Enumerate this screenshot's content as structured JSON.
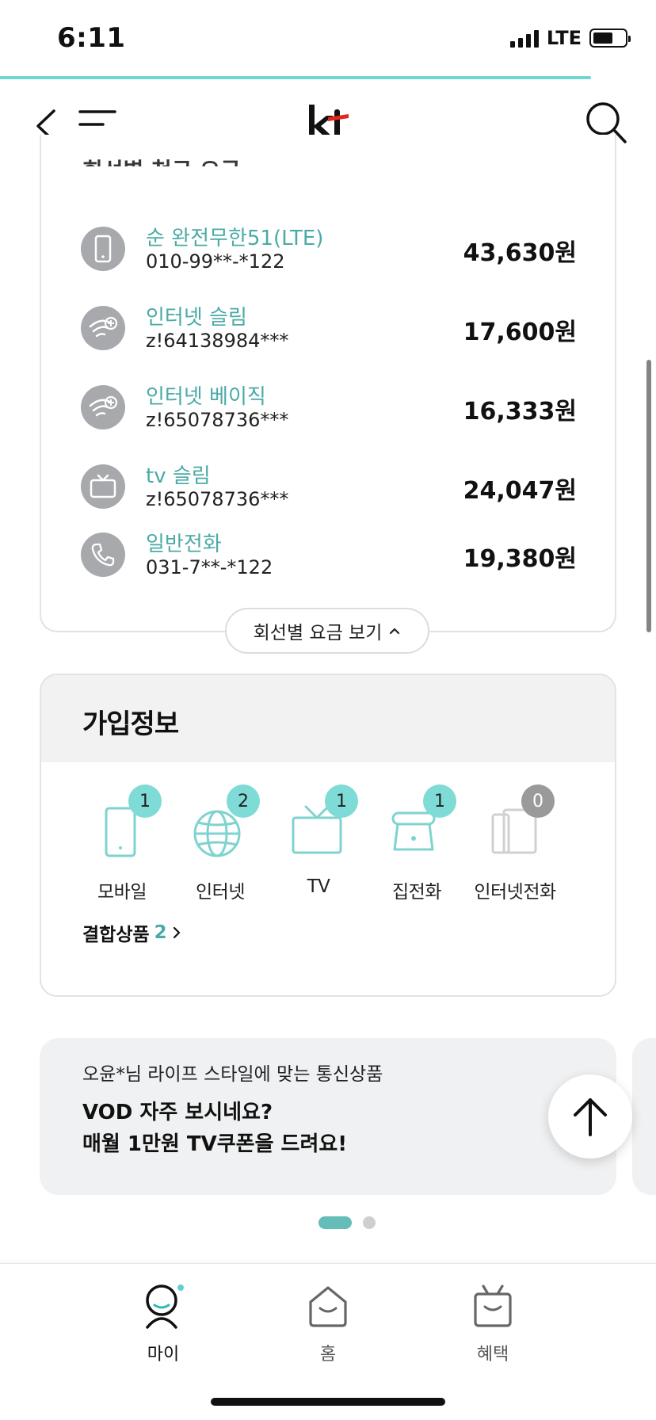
{
  "status_bar": {
    "time": "6:11",
    "network": "LTE"
  },
  "nav": {
    "logo_text": "kt"
  },
  "bill": {
    "section_title": "회선별 청구 요금",
    "lines": [
      {
        "icon": "phone-icon",
        "name": "순 완전무한51(LTE)",
        "number": "010-99**-*122",
        "price": "43,630원"
      },
      {
        "icon": "wifi-plus-icon",
        "name": "인터넷 슬림",
        "number": "z!64138984***",
        "price": "17,600원"
      },
      {
        "icon": "wifi-plus-icon",
        "name": "인터넷 베이직",
        "number": "z!65078736***",
        "price": "16,333원"
      },
      {
        "icon": "tv-icon",
        "name": "tv 슬림",
        "number": "z!65078736***",
        "price": "24,047원"
      },
      {
        "icon": "telephone-icon",
        "name": "일반전화",
        "number": "031-7**-*122",
        "price": "19,380원"
      }
    ],
    "toggle_label": "회선별 요금 보기"
  },
  "subscription": {
    "title": "가입정보",
    "products": [
      {
        "label": "모바일",
        "count": "1",
        "icon": "mobile-icon"
      },
      {
        "label": "인터넷",
        "count": "2",
        "icon": "globe-icon"
      },
      {
        "label": "TV",
        "count": "1",
        "icon": "tv-icon"
      },
      {
        "label": "집전화",
        "count": "1",
        "icon": "home-phone-icon"
      },
      {
        "label": "인터넷전화",
        "count": "0",
        "icon": "internet-phone-icon"
      }
    ],
    "bundle_label": "결합상품",
    "bundle_count": "2"
  },
  "promo": {
    "subtitle": "오윤*님 라이프 스타일에 맞는 통신상품",
    "title_line1": "VOD 자주 보시네요?",
    "title_line2": "매월 1만원 TV쿠폰을 드려요!"
  },
  "tabs": [
    {
      "label": "마이",
      "icon": "my-icon",
      "active": true
    },
    {
      "label": "홈",
      "icon": "home-icon",
      "active": false
    },
    {
      "label": "혜택",
      "icon": "gift-icon",
      "active": false
    }
  ],
  "colors": {
    "accent": "#49aaa6",
    "badge": "#7fdbd6",
    "brand_red": "#e4261a"
  }
}
